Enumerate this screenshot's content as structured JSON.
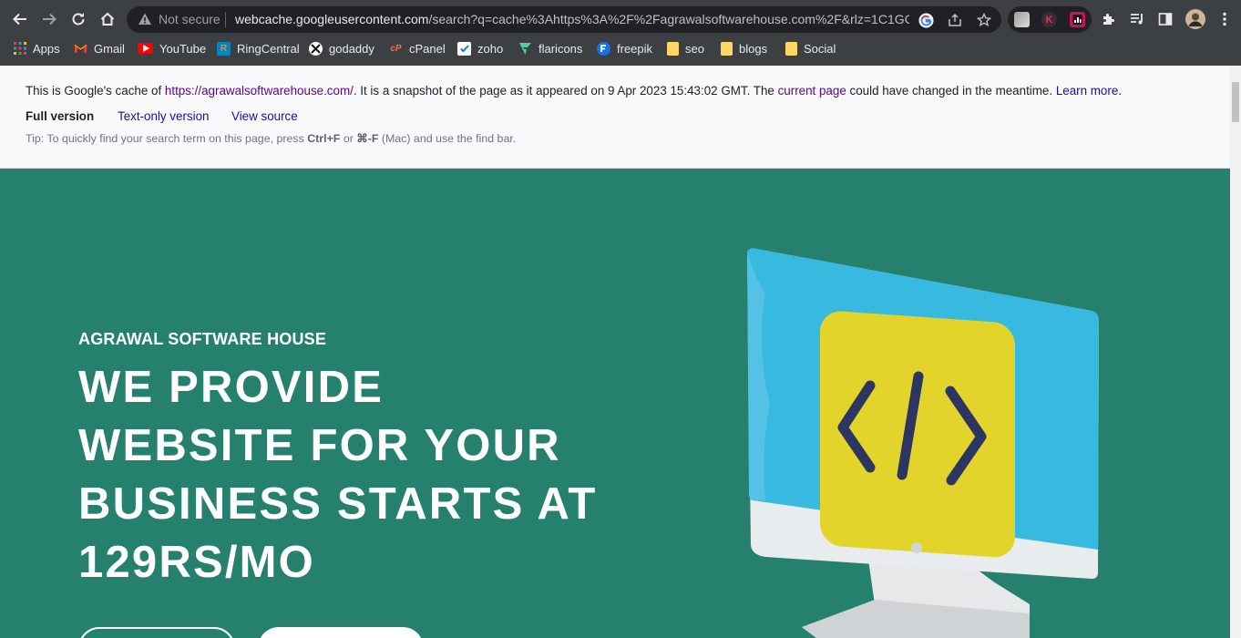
{
  "browser": {
    "omnibox": {
      "security_label": "Not secure",
      "url_host": "webcache.googleusercontent.com",
      "url_path": "/search?q=cache%3Ahttps%3A%2F%2Fagrawalsoftwarehouse.com%2F&rlz=1C1GC..."
    },
    "bookmarks": [
      {
        "label": "Apps",
        "icon": "apps-grid-icon"
      },
      {
        "label": "Gmail",
        "icon": "gmail-icon"
      },
      {
        "label": "YouTube",
        "icon": "youtube-icon"
      },
      {
        "label": "RingCentral",
        "icon": "ringcentral-icon"
      },
      {
        "label": "godaddy",
        "icon": "godaddy-icon"
      },
      {
        "label": "cPanel",
        "icon": "cpanel-icon"
      },
      {
        "label": "zoho",
        "icon": "zoho-icon"
      },
      {
        "label": "flaricons",
        "icon": "flaticon-icon"
      },
      {
        "label": "freepik",
        "icon": "freepik-icon"
      },
      {
        "label": "seo",
        "icon": "folder-icon"
      },
      {
        "label": "blogs",
        "icon": "folder-icon"
      },
      {
        "label": "Social",
        "icon": "folder-icon"
      }
    ],
    "colors": {
      "chrome_bg": "#3c4043",
      "omnibox_bg": "#202124"
    }
  },
  "cache": {
    "intro": "This is Google's cache of ",
    "source_url": "https://agrawalsoftwarehouse.com/",
    "snapshot_text": ". It is a snapshot of the page as it appeared on 9 Apr 2023 15:43:02 GMT. The ",
    "current_page": "current page",
    "changed_text": " could have changed in the meantime. ",
    "learn_more": "Learn more.",
    "full_version": "Full version",
    "text_only": "Text-only version",
    "view_source": "View source",
    "tip_prefix": "Tip: To quickly find your search term on this page, press ",
    "tip_key1": "Ctrl+F",
    "tip_or": " or ",
    "tip_key2": "⌘-F",
    "tip_suffix": " (Mac) and use the find bar."
  },
  "hero": {
    "brand": "AGRAWAL SOFTWARE HOUSE",
    "title_lines": [
      "WE PROVIDE",
      "WEBSITE FOR YOUR",
      "BUSINESS STARTS AT",
      "129RS/MO"
    ],
    "bg_color": "#25806e"
  }
}
